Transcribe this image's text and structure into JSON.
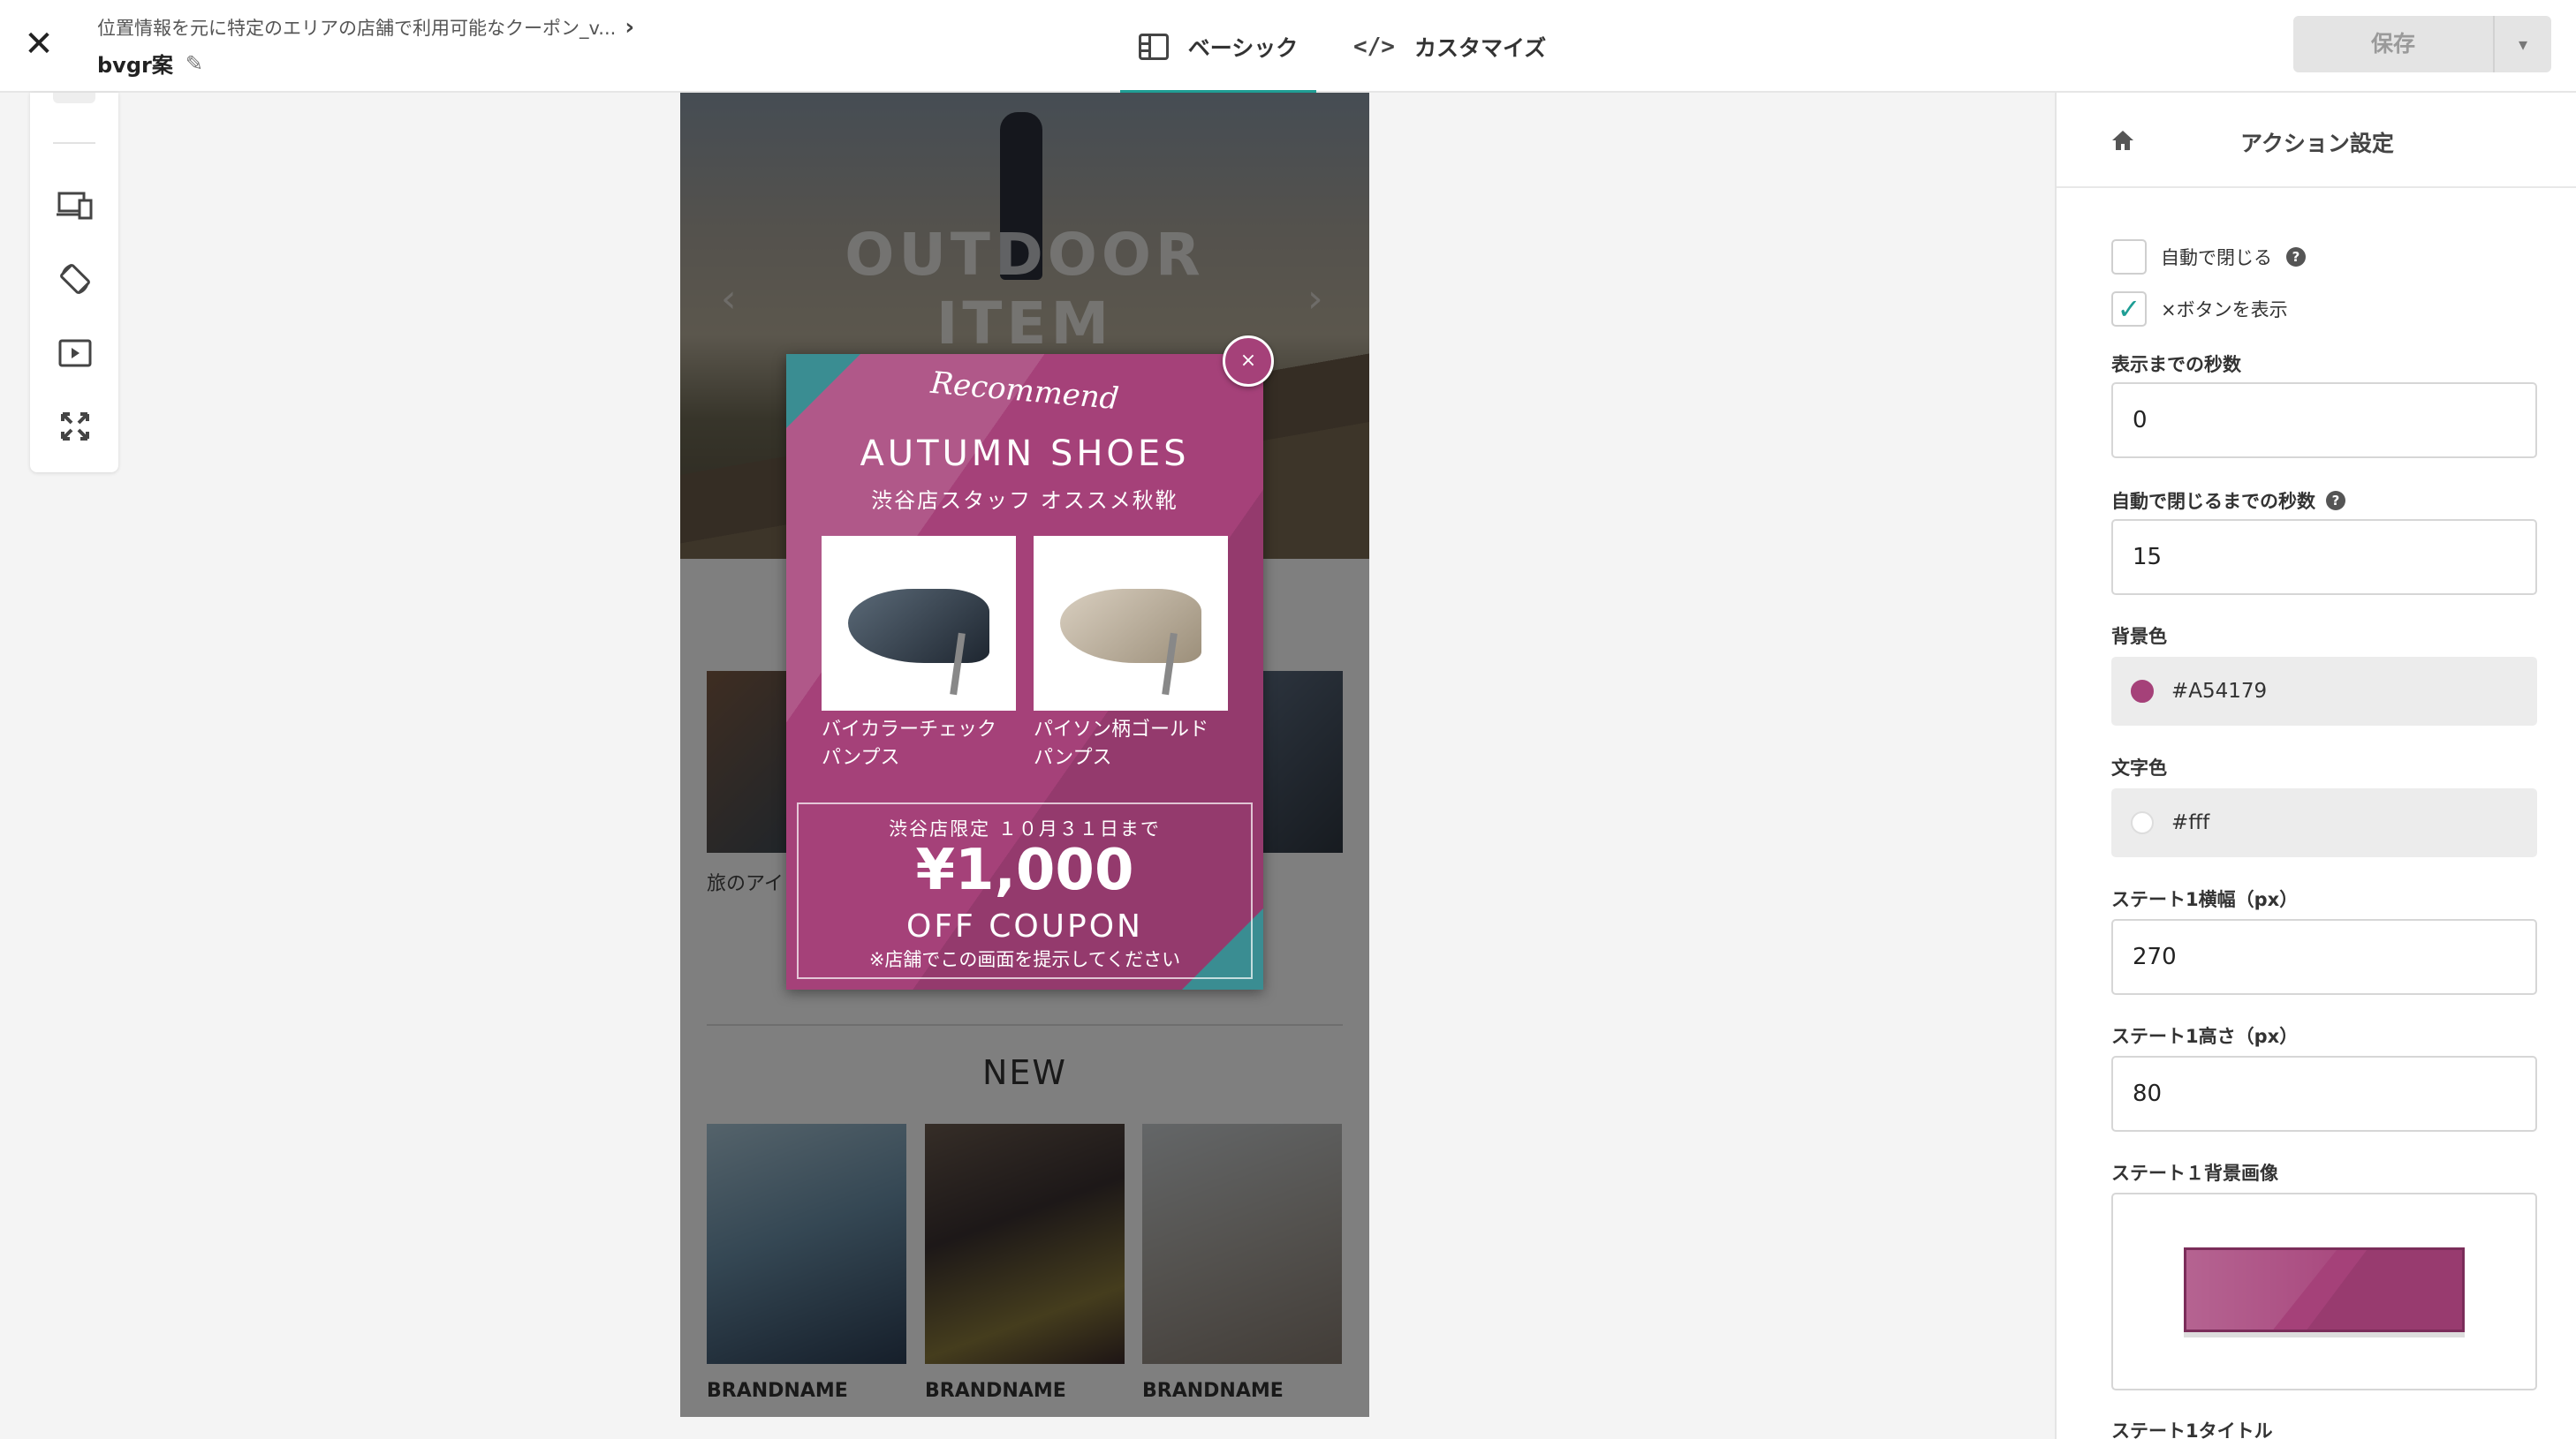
{
  "header": {
    "breadcrumb": "位置情報を元に特定のエリアの店舗で利用可能なクーポン_v...",
    "doc_name": "bvgr案",
    "tabs": [
      {
        "label": "ベーシック",
        "icon": "panel-icon",
        "active": true
      },
      {
        "label": "カスタマイズ",
        "icon": "code-icon",
        "active": false
      }
    ],
    "save_label": "保存",
    "accent_color": "#1f9e95"
  },
  "toolbar": {
    "tools": [
      "devices-icon",
      "rotate-icon",
      "play-icon",
      "expand-icon"
    ]
  },
  "preview": {
    "hero_title_line1": "OUTDOOR",
    "hero_title_line2": "ITEM",
    "hero_prev": "‹",
    "hero_next": "›",
    "side_caption": "旅のアイ",
    "new_heading": "NEW",
    "brands": [
      "BRANDNAME",
      "BRANDNAME",
      "BRANDNAME"
    ]
  },
  "popup": {
    "script_title": "Recommend",
    "title": "AUTUMN SHOES",
    "subtitle": "渋谷店スタッフ オススメ秋靴",
    "products": [
      {
        "name_line1": "バイカラーチェック",
        "name_line2": "パンプス"
      },
      {
        "name_line1": "パイソン柄ゴールド",
        "name_line2": "パンプス"
      }
    ],
    "coupon_limit": "渋谷店限定 １０月３１日まで",
    "coupon_price": "¥1,000",
    "coupon_off": "OFF COUPON",
    "coupon_note": "※店舗でこの画面を提示してください",
    "close_label": "×",
    "background_color": "#A54179",
    "corner_color": "#3a8d92"
  },
  "panel": {
    "title": "アクション設定",
    "auto_close_label": "自動で閉じる",
    "auto_close_checked": false,
    "show_close_label": "×ボタンを表示",
    "show_close_checked": true,
    "delay_label": "表示までの秒数",
    "delay_value": "0",
    "close_after_label": "自動で閉じるまでの秒数",
    "close_after_value": "15",
    "bg_color_label": "背景色",
    "bg_color_value": "#A54179",
    "text_color_label": "文字色",
    "text_color_value": "#fff",
    "state1_width_label": "ステート1横幅（px）",
    "state1_width_value": "270",
    "state1_height_label": "ステート1高さ（px）",
    "state1_height_value": "80",
    "state1_bg_image_label": "ステート１背景画像",
    "state1_title_label": "ステート1タイトル"
  }
}
